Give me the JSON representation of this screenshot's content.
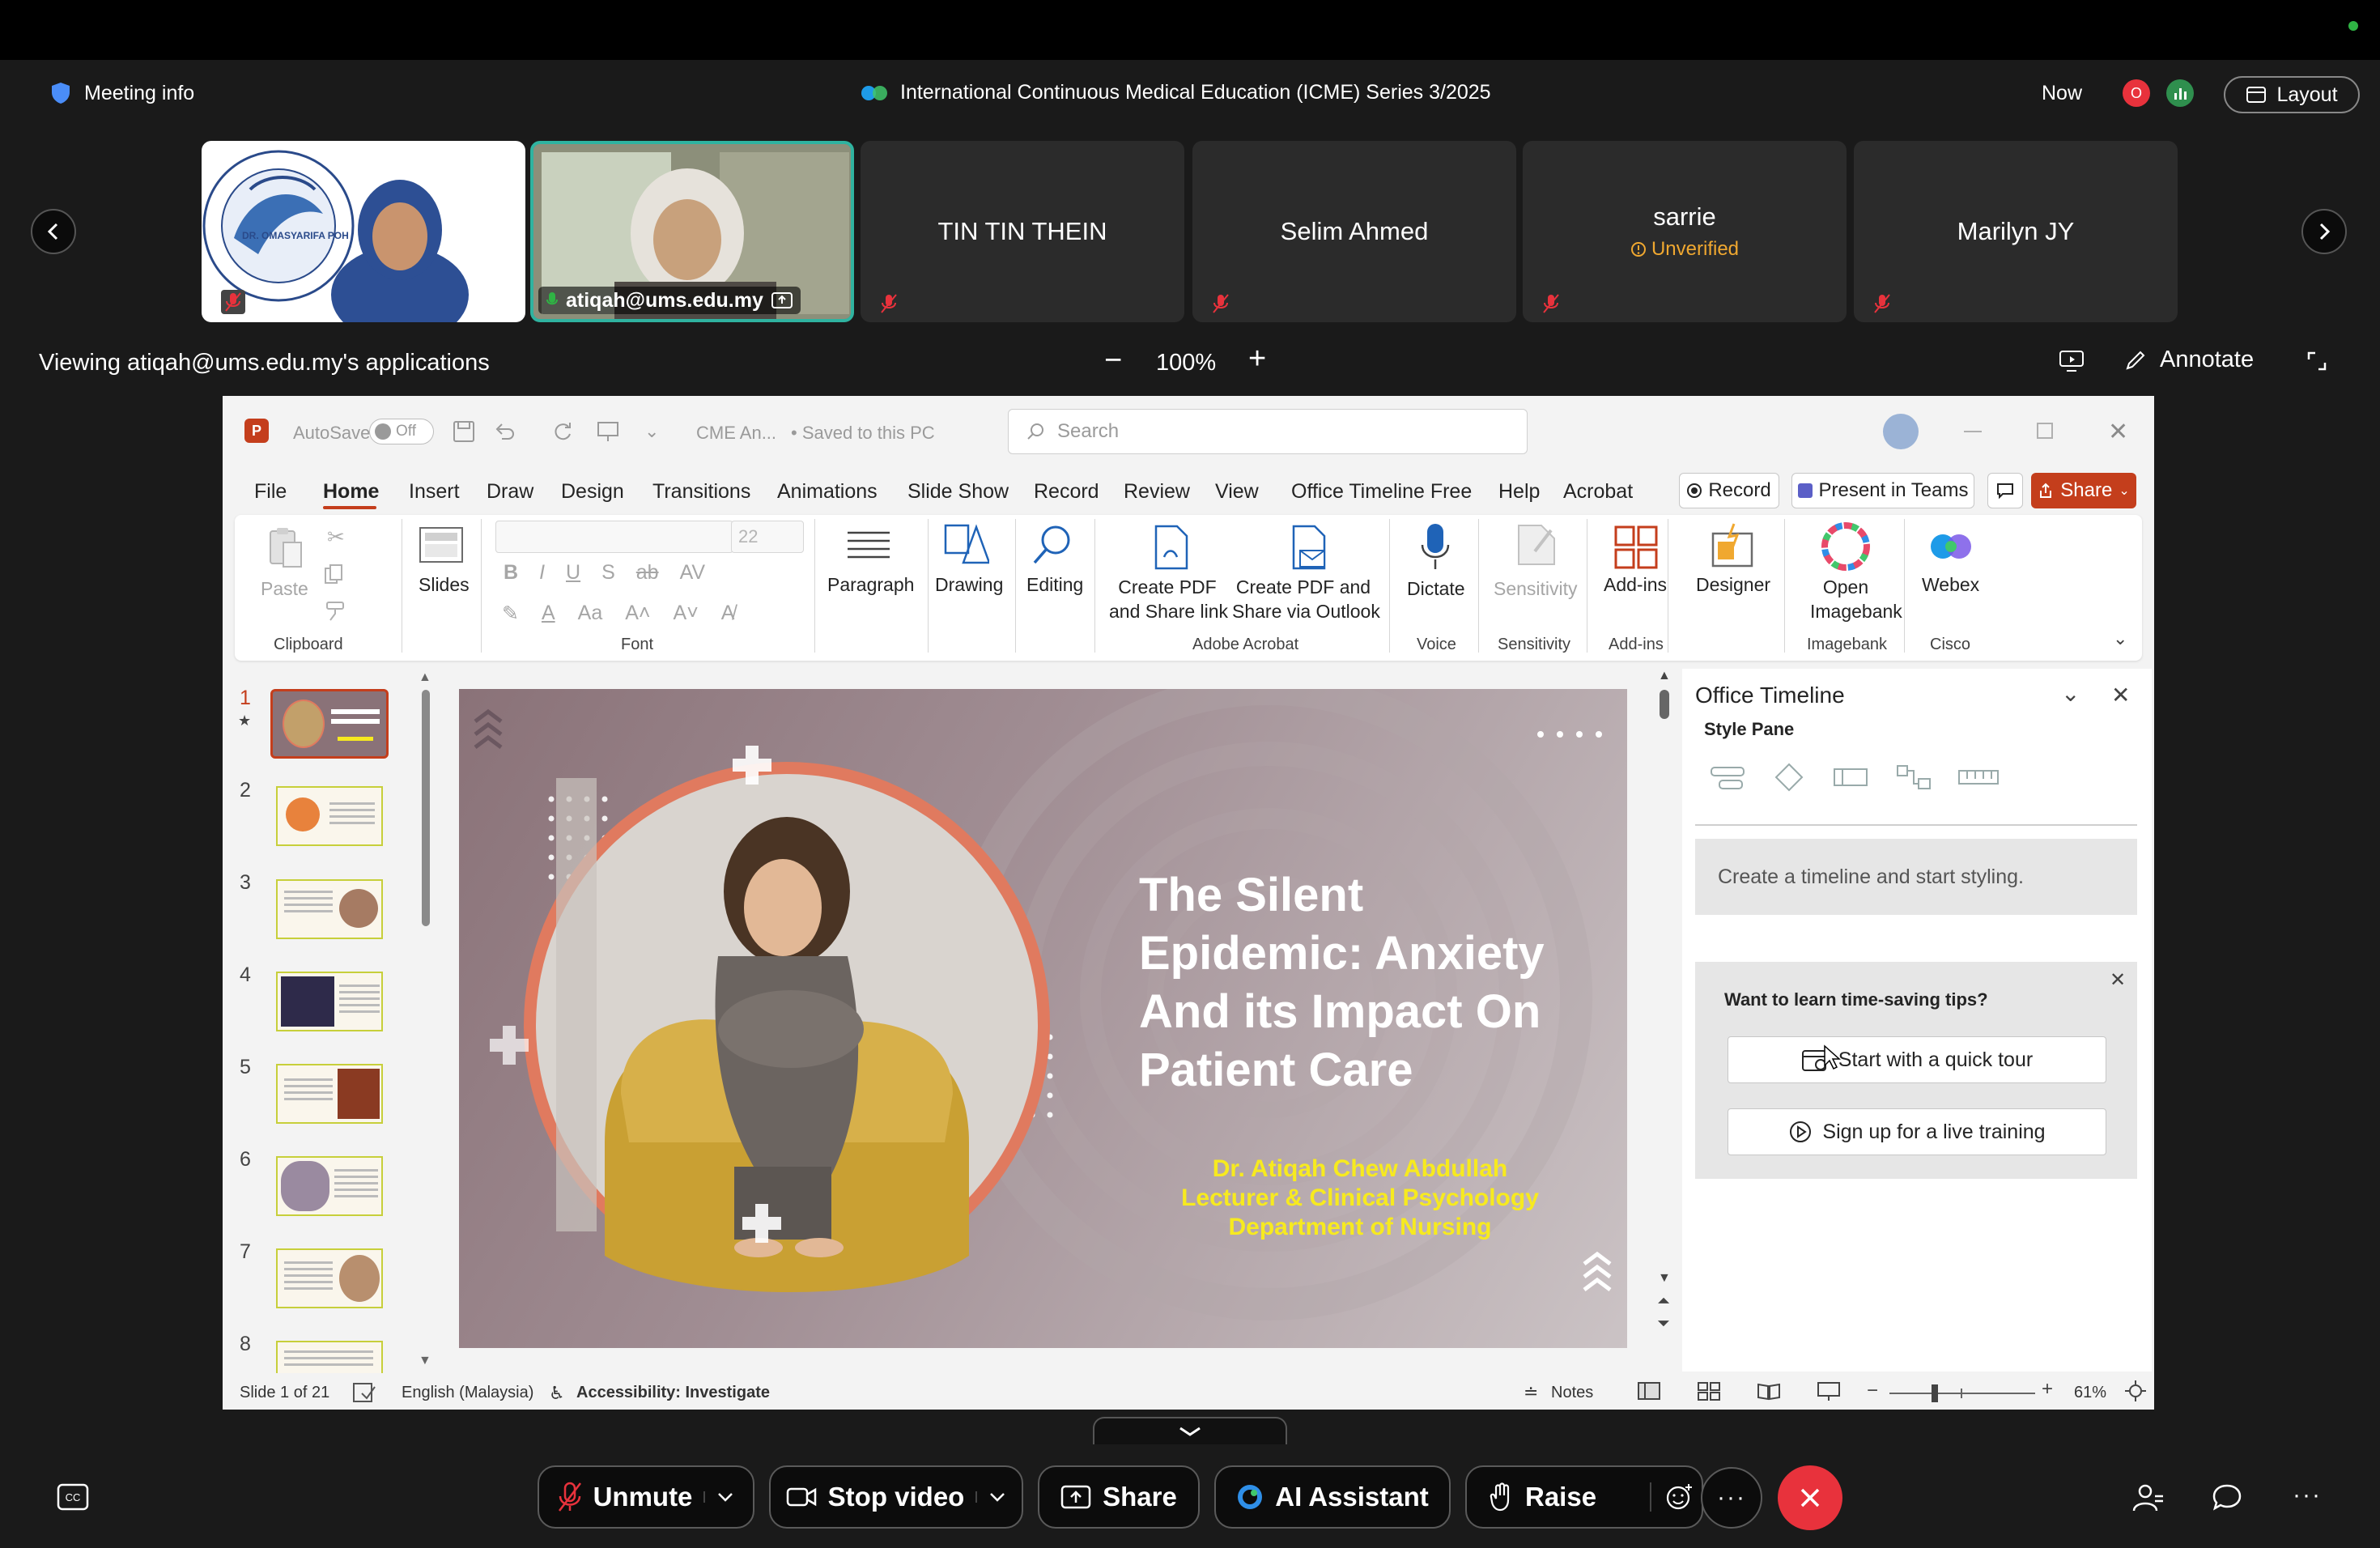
{
  "meeting": {
    "meeting_info": "Meeting info",
    "title": "International Continuous Medical Education (ICME) Series 3/2025",
    "time": "Now",
    "avatar_letter": "O",
    "layout_label": "Layout",
    "viewing": "Viewing atiqah@ums.edu.my's applications",
    "zoom": "100%",
    "annotate": "Annotate"
  },
  "participants": [
    {
      "name": "",
      "badge_text": "DR. OMASYARIFA POH"
    },
    {
      "name": "atiqah@ums.edu.my"
    },
    {
      "name": "TIN TIN THEIN"
    },
    {
      "name": "Selim Ahmed"
    },
    {
      "name": "sarrie",
      "status": "Unverified"
    },
    {
      "name": "Marilyn JY"
    }
  ],
  "ppt": {
    "autosave": "AutoSave",
    "autosave_state": "Off",
    "filename": "CME An...",
    "saved": "• Saved to this PC",
    "search_placeholder": "Search",
    "tabs": [
      "File",
      "Home",
      "Insert",
      "Draw",
      "Design",
      "Transitions",
      "Animations",
      "Slide Show",
      "Record",
      "Review",
      "View",
      "Office Timeline Free",
      "Help",
      "Acrobat"
    ],
    "active_tab": "Home",
    "record": "Record",
    "present_teams": "Present in Teams",
    "share": "Share",
    "ribbon": {
      "paste": "Paste",
      "clipboard": "Clipboard",
      "slides": "Slides",
      "font_size": "22",
      "font": "Font",
      "paragraph": "Paragraph",
      "drawing": "Drawing",
      "editing": "Editing",
      "create_pdf_share_1": "Create PDF",
      "create_pdf_share_2": "and Share link",
      "create_pdf_outlook_1": "Create PDF and",
      "create_pdf_outlook_2": "Share via Outlook",
      "adobe_acrobat": "Adobe Acrobat",
      "dictate": "Dictate",
      "voice": "Voice",
      "sensitivity_btn": "Sensitivity",
      "sensitivity": "Sensitivity",
      "add_ins_btn": "Add-ins",
      "add_ins": "Add-ins",
      "designer": "Designer",
      "open_imagebank_1": "Open",
      "open_imagebank_2": "Imagebank",
      "imagebank": "Imagebank",
      "webex": "Webex",
      "cisco": "Cisco"
    },
    "thumbnails": [
      "1",
      "2",
      "3",
      "4",
      "5",
      "6",
      "7",
      "8"
    ],
    "slide": {
      "title_lines": [
        "The Silent",
        "Epidemic: Anxiety",
        "And its Impact On",
        "Patient Care"
      ],
      "subtitle_lines": [
        "Dr. Atiqah Chew Abdullah",
        "Lecturer & Clinical Psychology",
        "Department of Nursing"
      ]
    },
    "pane": {
      "title": "Office Timeline",
      "style_pane": "Style Pane",
      "create_msg": "Create a timeline and start styling.",
      "tips_title": "Want to learn time-saving tips?",
      "quick_tour": "Start with a quick tour",
      "live_training": "Sign up for a live training"
    },
    "status": {
      "slide": "Slide 1 of 21",
      "language": "English (Malaysia)",
      "accessibility": "Accessibility: Investigate",
      "notes": "Notes",
      "zoom": "61%"
    }
  },
  "controls": {
    "unmute": "Unmute",
    "stop_video": "Stop video",
    "share": "Share",
    "ai_assistant": "AI Assistant",
    "raise": "Raise"
  },
  "colors": {
    "webex_green": "#2fb344",
    "end_red": "#e8323c",
    "ppt_orange": "#c43e1c",
    "slide_yellow": "#f7ea1f"
  }
}
